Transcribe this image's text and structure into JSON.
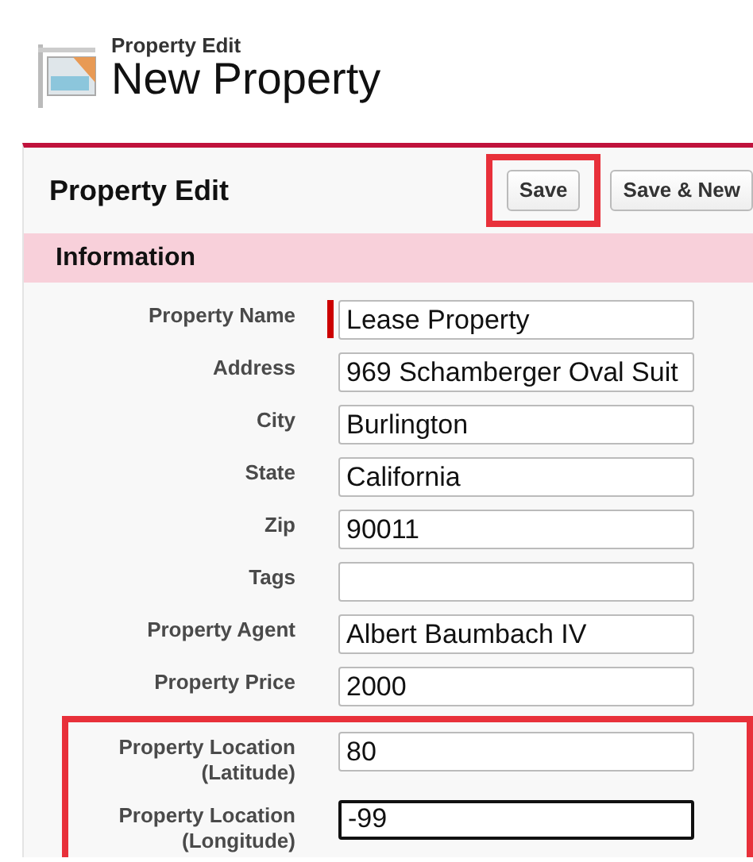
{
  "page_header": {
    "subtitle": "Property Edit",
    "title": "New Property"
  },
  "panel": {
    "title": "Property Edit",
    "buttons": [
      {
        "label": "Save",
        "highlighted": true
      },
      {
        "label": "Save & New",
        "highlighted": false
      }
    ],
    "section": {
      "title": "Information"
    },
    "fields": [
      {
        "label": "Property Name",
        "value": "Lease Property",
        "required": true,
        "focused": false,
        "highlighted": false
      },
      {
        "label": "Address",
        "value": "969 Schamberger Oval Suit",
        "required": false,
        "focused": false,
        "highlighted": false
      },
      {
        "label": "City",
        "value": "Burlington",
        "required": false,
        "focused": false,
        "highlighted": false
      },
      {
        "label": "State",
        "value": "California",
        "required": false,
        "focused": false,
        "highlighted": false
      },
      {
        "label": "Zip",
        "value": "90011",
        "required": false,
        "focused": false,
        "highlighted": false
      },
      {
        "label": "Tags",
        "required": false,
        "focused": false,
        "highlighted": false
      },
      {
        "label": "Property Agent",
        "value": "Albert Baumbach IV",
        "required": false,
        "focused": false,
        "highlighted": false
      },
      {
        "label": "Property Price",
        "value": "2000",
        "required": false,
        "focused": false,
        "highlighted": false
      },
      {
        "label": "Property Location (Latitude)",
        "value": "80",
        "required": false,
        "focused": false,
        "highlighted": true
      },
      {
        "label": "Property Location (Longitude)",
        "value": "-99",
        "required": false,
        "focused": true,
        "highlighted": true
      }
    ]
  }
}
